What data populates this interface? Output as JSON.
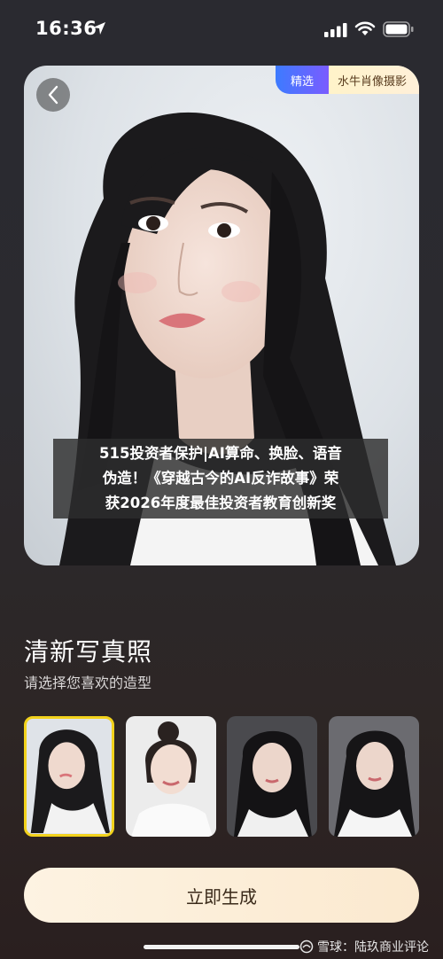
{
  "status_bar": {
    "time": "16:36"
  },
  "hero": {
    "tag_featured": "精选",
    "tag_studio": "水牛肖像摄影",
    "caption_lines": [
      "515投资者保护|AI算命、换脸、语音",
      "伪造！《穿越古今的AI反诈故事》荣",
      "获2026年度最佳投资者教育创新奖"
    ]
  },
  "section": {
    "title": "清新写真照",
    "subtitle": "请选择您喜欢的造型"
  },
  "styles": [
    {
      "selected": true,
      "bg": "#dfe3e8"
    },
    {
      "selected": false,
      "bg": "#ececec"
    },
    {
      "selected": false,
      "bg": "#4a4a4e"
    },
    {
      "selected": false,
      "bg": "#6b6b70"
    }
  ],
  "cta": {
    "label": "立即生成"
  },
  "watermark": {
    "text": "雪球：陆玖商业评论"
  },
  "colors": {
    "accent_gold": "#f2d21c",
    "cta_bg": "#fbe9cf",
    "tag_blue": "#3d7bff"
  }
}
